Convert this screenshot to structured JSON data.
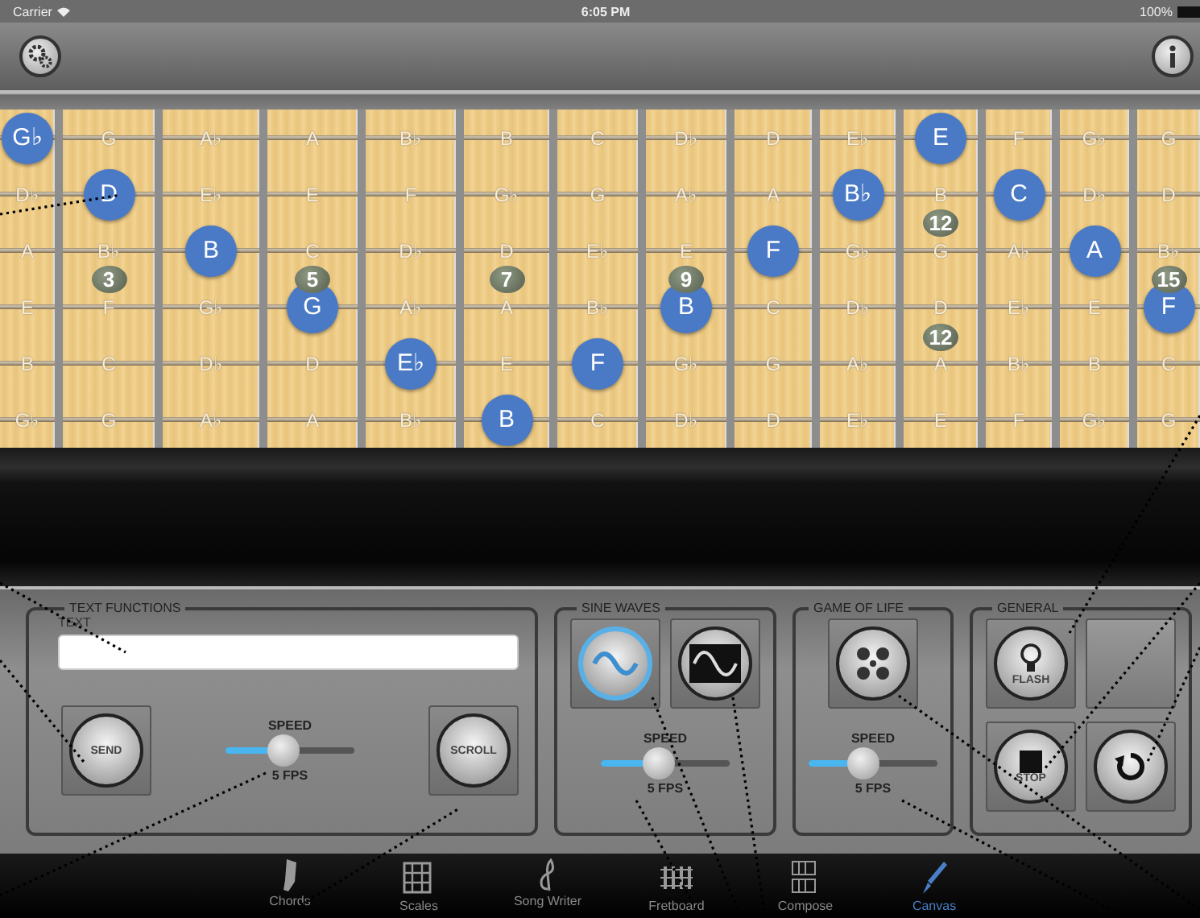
{
  "status_bar": {
    "carrier": "Carrier",
    "time": "6:05 PM",
    "battery": "100%"
  },
  "fretboard": {
    "frets": [
      {
        "notes": [
          {
            "note": "G♭",
            "highlighted": true
          },
          {
            "note": "D♭",
            "highlighted": false
          },
          {
            "note": "A",
            "highlighted": false
          },
          {
            "note": "E",
            "highlighted": false
          },
          {
            "note": "B",
            "highlighted": false
          },
          {
            "note": "G♭",
            "highlighted": false
          }
        ]
      },
      {
        "notes": [
          {
            "note": "G",
            "highlighted": false
          },
          {
            "note": "D",
            "highlighted": true
          },
          {
            "note": "B♭",
            "highlighted": false
          },
          {
            "note": "F",
            "highlighted": false
          },
          {
            "note": "C",
            "highlighted": false
          },
          {
            "note": "G",
            "highlighted": false
          }
        ],
        "inlays": [
          "3"
        ]
      },
      {
        "notes": [
          {
            "note": "A♭",
            "highlighted": false
          },
          {
            "note": "E♭",
            "highlighted": false
          },
          {
            "note": "B",
            "highlighted": true
          },
          {
            "note": "G♭",
            "highlighted": false
          },
          {
            "note": "D♭",
            "highlighted": false
          },
          {
            "note": "A♭",
            "highlighted": false
          }
        ]
      },
      {
        "notes": [
          {
            "note": "A",
            "highlighted": false
          },
          {
            "note": "E",
            "highlighted": false
          },
          {
            "note": "C",
            "highlighted": false
          },
          {
            "note": "G",
            "highlighted": true
          },
          {
            "note": "D",
            "highlighted": false
          },
          {
            "note": "A",
            "highlighted": false
          }
        ],
        "inlays": [
          "5"
        ]
      },
      {
        "notes": [
          {
            "note": "B♭",
            "highlighted": false
          },
          {
            "note": "F",
            "highlighted": false
          },
          {
            "note": "D♭",
            "highlighted": false
          },
          {
            "note": "A♭",
            "highlighted": false
          },
          {
            "note": "E♭",
            "highlighted": true
          },
          {
            "note": "B♭",
            "highlighted": false
          }
        ]
      },
      {
        "notes": [
          {
            "note": "B",
            "highlighted": false
          },
          {
            "note": "G♭",
            "highlighted": false
          },
          {
            "note": "D",
            "highlighted": false
          },
          {
            "note": "A",
            "highlighted": false
          },
          {
            "note": "E",
            "highlighted": false
          },
          {
            "note": "B",
            "highlighted": true
          }
        ],
        "inlays": [
          "7"
        ]
      },
      {
        "notes": [
          {
            "note": "C",
            "highlighted": false
          },
          {
            "note": "G",
            "highlighted": false
          },
          {
            "note": "E♭",
            "highlighted": false
          },
          {
            "note": "B♭",
            "highlighted": false
          },
          {
            "note": "F",
            "highlighted": true
          },
          {
            "note": "C",
            "highlighted": false
          }
        ]
      },
      {
        "notes": [
          {
            "note": "D♭",
            "highlighted": false
          },
          {
            "note": "A♭",
            "highlighted": false
          },
          {
            "note": "E",
            "highlighted": false
          },
          {
            "note": "B",
            "highlighted": true
          },
          {
            "note": "G♭",
            "highlighted": false
          },
          {
            "note": "D♭",
            "highlighted": false
          }
        ],
        "inlays": [
          "9"
        ]
      },
      {
        "notes": [
          {
            "note": "D",
            "highlighted": false
          },
          {
            "note": "A",
            "highlighted": false
          },
          {
            "note": "F",
            "highlighted": true
          },
          {
            "note": "C",
            "highlighted": false
          },
          {
            "note": "G",
            "highlighted": false
          },
          {
            "note": "D",
            "highlighted": false
          }
        ]
      },
      {
        "notes": [
          {
            "note": "E♭",
            "highlighted": false
          },
          {
            "note": "B♭",
            "highlighted": true
          },
          {
            "note": "G♭",
            "highlighted": false
          },
          {
            "note": "D♭",
            "highlighted": false
          },
          {
            "note": "A♭",
            "highlighted": false
          },
          {
            "note": "E♭",
            "highlighted": false
          }
        ]
      },
      {
        "notes": [
          {
            "note": "E",
            "highlighted": true
          },
          {
            "note": "B",
            "highlighted": false
          },
          {
            "note": "G",
            "highlighted": false
          },
          {
            "note": "D",
            "highlighted": false
          },
          {
            "note": "A",
            "highlighted": false
          },
          {
            "note": "E",
            "highlighted": false
          }
        ],
        "inlays": [
          "12",
          "12"
        ]
      },
      {
        "notes": [
          {
            "note": "F",
            "highlighted": false
          },
          {
            "note": "C",
            "highlighted": true
          },
          {
            "note": "A♭",
            "highlighted": false
          },
          {
            "note": "E♭",
            "highlighted": false
          },
          {
            "note": "B♭",
            "highlighted": false
          },
          {
            "note": "F",
            "highlighted": false
          }
        ]
      },
      {
        "notes": [
          {
            "note": "G♭",
            "highlighted": false
          },
          {
            "note": "D♭",
            "highlighted": false
          },
          {
            "note": "A",
            "highlighted": true
          },
          {
            "note": "E",
            "highlighted": false
          },
          {
            "note": "B",
            "highlighted": false
          },
          {
            "note": "G♭",
            "highlighted": false
          }
        ]
      },
      {
        "notes": [
          {
            "note": "G",
            "highlighted": false
          },
          {
            "note": "D",
            "highlighted": false
          },
          {
            "note": "B♭",
            "highlighted": false
          },
          {
            "note": "F",
            "highlighted": true
          },
          {
            "note": "C",
            "highlighted": false
          },
          {
            "note": "G",
            "highlighted": false
          }
        ],
        "inlays": [
          "15"
        ]
      }
    ]
  },
  "panel": {
    "groups": [
      {
        "kind": "text",
        "title": "TEXT FUNCTIONS",
        "field_label": "TEXT",
        "buttons": [
          "SEND",
          "SCROLL"
        ],
        "speed": {
          "label": "SPEED",
          "level": 0.45,
          "reading": "5 FPS"
        }
      },
      {
        "kind": "sine",
        "title": "SINE WAVES",
        "modes": [
          {
            "kind": "wave",
            "selected": true
          },
          {
            "kind": "framed-wave",
            "selected": false
          }
        ],
        "speed": {
          "label": "SPEED",
          "level": 0.45,
          "reading": "5 FPS"
        }
      },
      {
        "kind": "life",
        "title": "GAME OF LIFE",
        "speed": {
          "label": "SPEED",
          "level": 0.42,
          "reading": "5 FPS"
        }
      },
      {
        "kind": "general",
        "title": "GENERAL",
        "items": [
          {
            "kind": "flash",
            "label": "FLASH"
          },
          {
            "kind": "blank"
          },
          {
            "kind": "stop",
            "label": "STOP"
          },
          {
            "kind": "reset"
          }
        ]
      }
    ]
  },
  "tab_bar": {
    "tabs": [
      {
        "kind": "chords",
        "label": "Chords",
        "selected": false
      },
      {
        "kind": "scales",
        "label": "Scales",
        "selected": false
      },
      {
        "kind": "songwriter",
        "label": "Song Writer",
        "selected": false
      },
      {
        "kind": "fretboard",
        "label": "Fretboard",
        "selected": false
      },
      {
        "kind": "compose",
        "label": "Compose",
        "selected": false
      },
      {
        "kind": "canvas",
        "label": "Canvas",
        "selected": true
      }
    ]
  }
}
